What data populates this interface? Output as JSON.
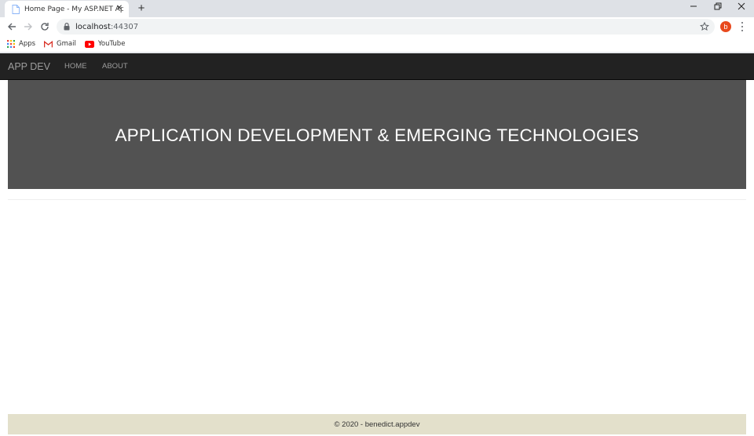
{
  "browser": {
    "tab": {
      "title": "Home Page - My ASP.NET Applic",
      "close_glyph": "✕"
    },
    "newtab_glyph": "+",
    "window_controls": {
      "minimize": "—",
      "restore": "❐",
      "close": "✕"
    },
    "url": {
      "host": "localhost",
      "port": ":44307"
    },
    "profile_initial": "b",
    "bookmarks": [
      {
        "label": "Apps",
        "icon": "apps-grid-icon"
      },
      {
        "label": "Gmail",
        "icon": "gmail-icon"
      },
      {
        "label": "YouTube",
        "icon": "youtube-icon"
      }
    ]
  },
  "site": {
    "brand": "APP DEV",
    "nav": [
      {
        "label": "HOME"
      },
      {
        "label": "ABOUT"
      }
    ],
    "hero_title": "APPLICATION DEVELOPMENT & EMERGING TECHNOLOGIES",
    "footer": "© 2020 - benedict.appdev"
  },
  "colors": {
    "navbar": "#222222",
    "hero": "#525252",
    "footer": "#e3e0cb",
    "avatar": "#e8491d",
    "youtube": "#ff0000",
    "gmail": "#d93025"
  }
}
